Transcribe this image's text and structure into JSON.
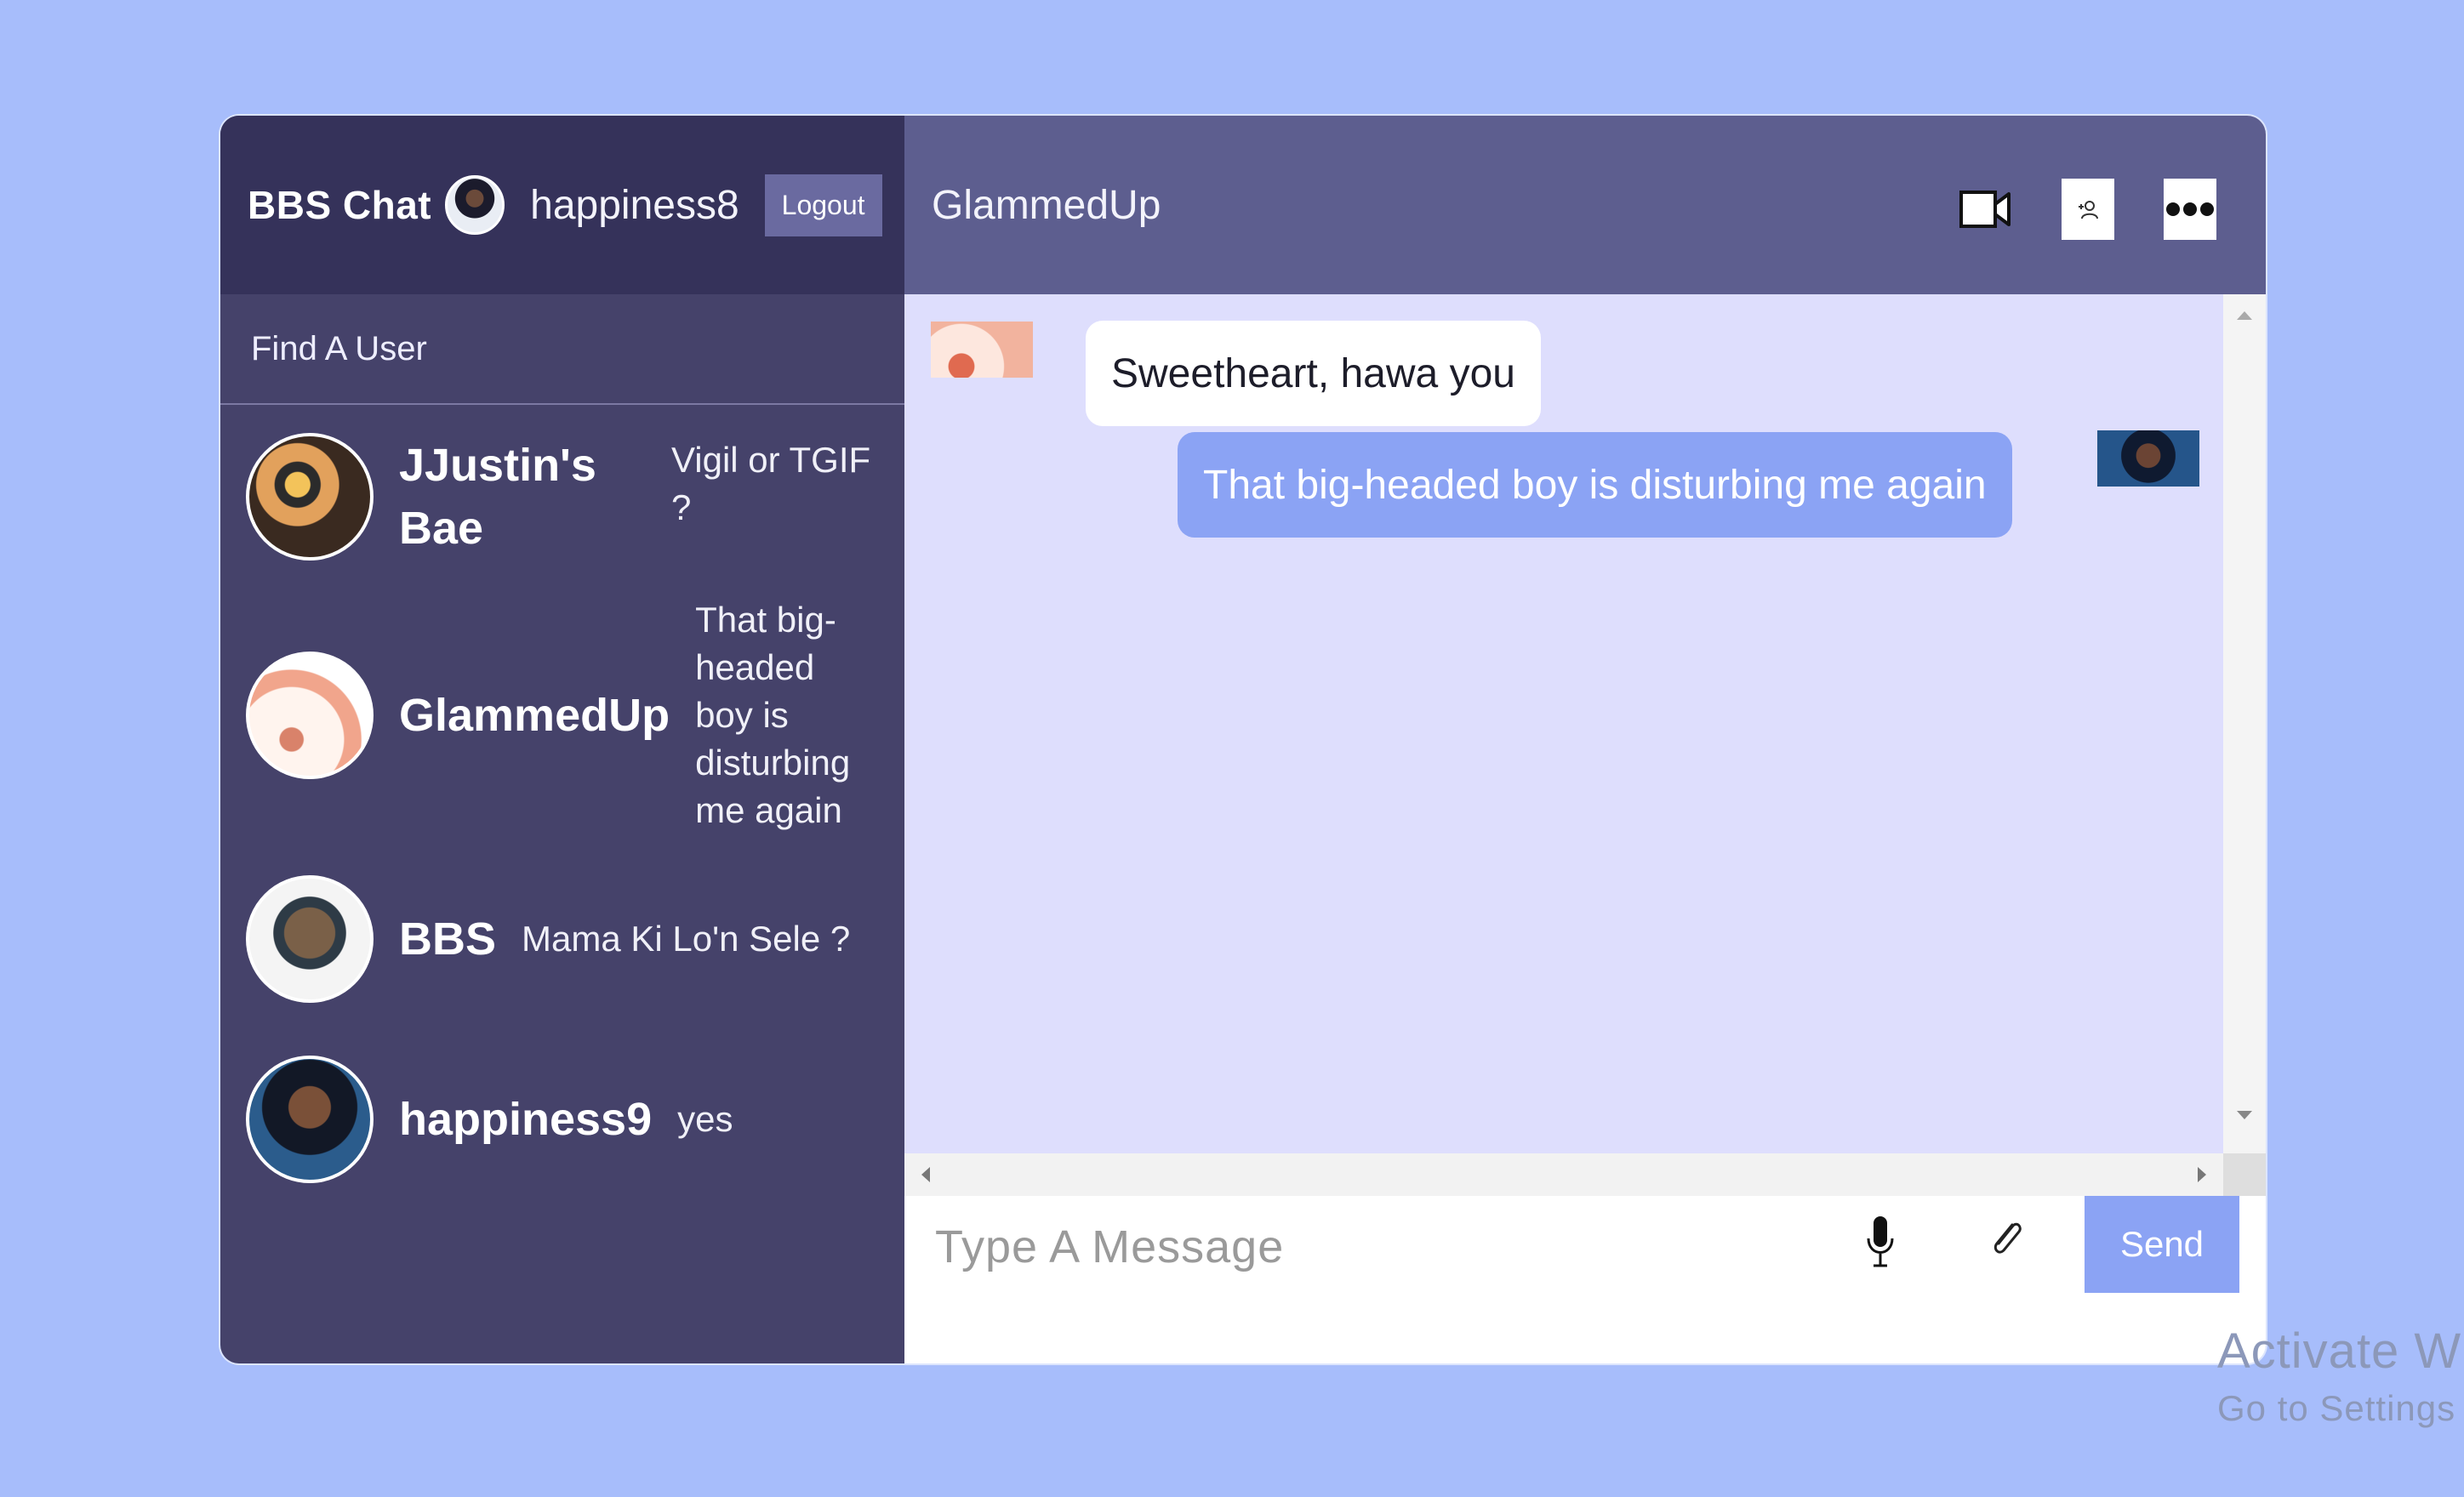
{
  "app": {
    "brand": "BBS Chat",
    "current_user": "happiness8",
    "logout_label": "Logout"
  },
  "sidebar": {
    "find_user_label": "Find A User",
    "contacts": [
      {
        "name": "JJustin's Bae",
        "preview": "Vigil or TGIF ?"
      },
      {
        "name": "GlammedUp",
        "preview": "That big-headed boy is disturbing me again"
      },
      {
        "name": "BBS",
        "preview": "Mama Ki Lo'n Sele ?"
      },
      {
        "name": "happiness9",
        "preview": "yes"
      }
    ]
  },
  "chat": {
    "title": "GlammedUp",
    "header_icons": [
      "video-camera-icon",
      "add-user-icon",
      "more-options-icon"
    ],
    "messages": [
      {
        "direction": "incoming",
        "text": "Sweetheart, hawa you"
      },
      {
        "direction": "outgoing",
        "text": "That big-headed boy is disturbing me again"
      }
    ],
    "composer": {
      "placeholder": "Type A Message",
      "send_label": "Send"
    }
  },
  "watermark": {
    "line1": "Activate Wi",
    "line2": "Go to Settings"
  },
  "colors": {
    "page_background": "#a7bdfb",
    "sidebar": "#45426a",
    "sidebar_header": "#35325a",
    "chat_header": "#5d5e8f",
    "messages_background": "#dedefd",
    "accent": "#8ba3f4"
  }
}
